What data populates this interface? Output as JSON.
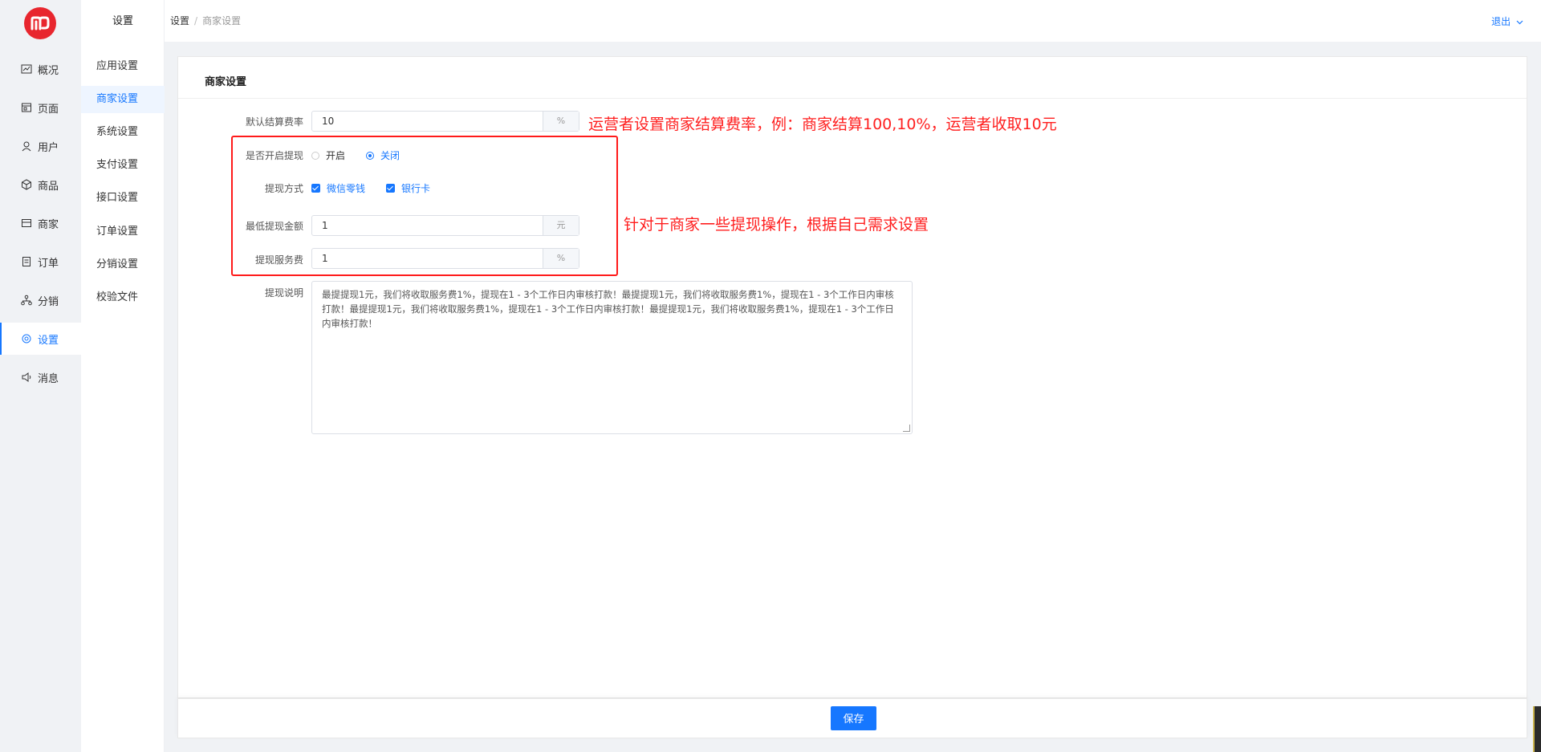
{
  "nav1": {
    "items": [
      {
        "label": "概况",
        "icon": "chart-line-icon"
      },
      {
        "label": "页面",
        "icon": "page-icon"
      },
      {
        "label": "用户",
        "icon": "user-icon"
      },
      {
        "label": "商品",
        "icon": "cube-icon"
      },
      {
        "label": "商家",
        "icon": "store-icon"
      },
      {
        "label": "订单",
        "icon": "order-icon"
      },
      {
        "label": "分销",
        "icon": "network-icon"
      },
      {
        "label": "设置",
        "icon": "gear-icon"
      },
      {
        "label": "消息",
        "icon": "speaker-icon"
      }
    ],
    "active": "设置",
    "accent": "#1677ff",
    "logo_color": "#e8262e"
  },
  "nav2": {
    "title": "设置",
    "items": [
      "应用设置",
      "商家设置",
      "系统设置",
      "支付设置",
      "接口设置",
      "订单设置",
      "分销设置",
      "校验文件"
    ],
    "active": "商家设置"
  },
  "header": {
    "breadcrumb": [
      "设置",
      "商家设置"
    ],
    "logout": "退出"
  },
  "card": {
    "title": "商家设置",
    "fields": {
      "rate_label": "默认结算费率",
      "rate_value": "10",
      "rate_unit": "%",
      "withdraw_label": "是否开启提现",
      "withdraw_on": "开启",
      "withdraw_off": "关闭",
      "method_label": "提现方式",
      "method_wechat": "微信零钱",
      "method_bank": "银行卡",
      "min_label": "最低提现金额",
      "min_value": "1",
      "min_unit": "元",
      "fee_label": "提现服务费",
      "fee_value": "1",
      "fee_unit": "%",
      "desc_label": "提现说明",
      "desc_value": "最提提现1元，我们将收取服务费1%，提现在1 - 3个工作日内审核打款！最提提现1元，我们将收取服务费1%，提现在1 - 3个工作日内审核打款！最提提现1元，我们将收取服务费1%，提现在1 - 3个工作日内审核打款！最提提现1元，我们将收取服务费1%，提现在1 - 3个工作日内审核打款！"
    }
  },
  "notes": {
    "rate": "运营者设置商家结算费率，例：商家结算100,10%，运营者收取10元",
    "withdraw": "针对于商家一些提现操作，根据自己需求设置"
  },
  "footer": {
    "save": "保存"
  }
}
